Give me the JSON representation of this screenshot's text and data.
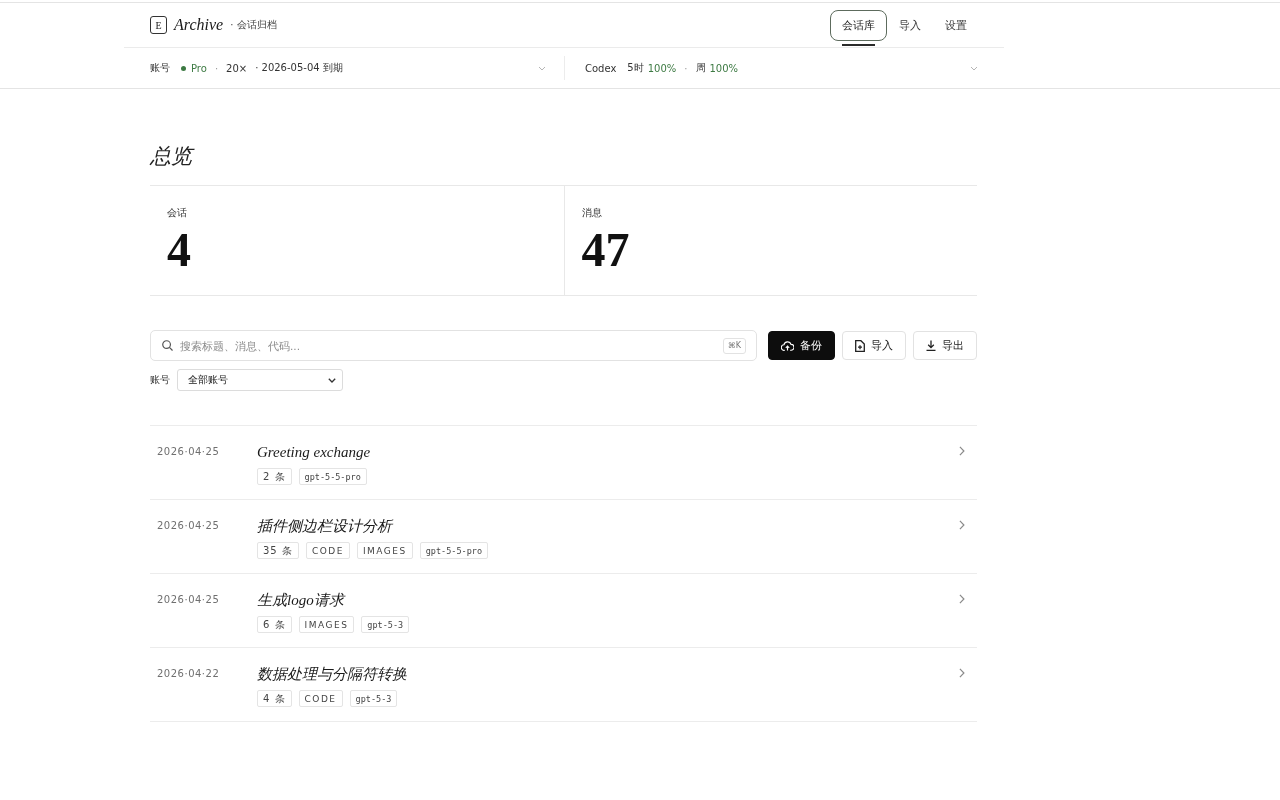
{
  "header": {
    "logo": "E",
    "brand": "Archive",
    "subtitle": "· 会话归档",
    "nav": [
      {
        "label": "会话库",
        "selected": true
      },
      {
        "label": "导入",
        "selected": false
      },
      {
        "label": "设置",
        "selected": false
      }
    ]
  },
  "account_bar": {
    "account": {
      "label": "账号",
      "summary": [
        {
          "text": "Pro",
          "kind": "plan"
        },
        {
          "text": "·",
          "kind": "sep"
        },
        {
          "text": "20×",
          "kind": "plain"
        },
        {
          "text": "· 2026-05-04 到期",
          "kind": "plain"
        }
      ]
    },
    "codex": {
      "label": "Codex",
      "usage": [
        {
          "text": "5时",
          "kind": "label"
        },
        {
          "text": "100%",
          "kind": "value"
        },
        {
          "text": "·",
          "kind": "sep"
        },
        {
          "text": "周",
          "kind": "label"
        },
        {
          "text": "100%",
          "kind": "value"
        }
      ]
    }
  },
  "overview": {
    "title": "总览",
    "stats": [
      {
        "label": "会话",
        "value": "4"
      },
      {
        "label": "消息",
        "value": "47"
      }
    ]
  },
  "toolbar": {
    "search": {
      "placeholder": "搜索标题、消息、代码...",
      "shortcut": "⌘K"
    },
    "buttons": [
      {
        "label": "备份",
        "kind": "primary"
      },
      {
        "label": "导入",
        "kind": "plain"
      },
      {
        "label": "导出",
        "kind": "plain"
      }
    ]
  },
  "filter": {
    "label": "账号",
    "value": "全部账号"
  },
  "conversations": [
    {
      "date": "2026·04·25",
      "title": "Greeting exchange",
      "tags": [
        {
          "text": "2 条",
          "kind": "count"
        },
        {
          "text": "gpt-5-5-pro",
          "kind": "model"
        }
      ]
    },
    {
      "date": "2026·04·25",
      "title": "插件侧边栏设计分析",
      "tags": [
        {
          "text": "35 条",
          "kind": "count"
        },
        {
          "text": "CODE",
          "kind": "feature"
        },
        {
          "text": "IMAGES",
          "kind": "feature"
        },
        {
          "text": "gpt-5-5-pro",
          "kind": "model"
        }
      ]
    },
    {
      "date": "2026·04·25",
      "title": "生成logo请求",
      "tags": [
        {
          "text": "6 条",
          "kind": "count"
        },
        {
          "text": "IMAGES",
          "kind": "feature"
        },
        {
          "text": "gpt-5-3",
          "kind": "model"
        }
      ]
    },
    {
      "date": "2026·04·22",
      "title": "数据处理与分隔符转换",
      "tags": [
        {
          "text": "4 条",
          "kind": "count"
        },
        {
          "text": "CODE",
          "kind": "feature"
        },
        {
          "text": "gpt-5-3",
          "kind": "model"
        }
      ]
    }
  ]
}
